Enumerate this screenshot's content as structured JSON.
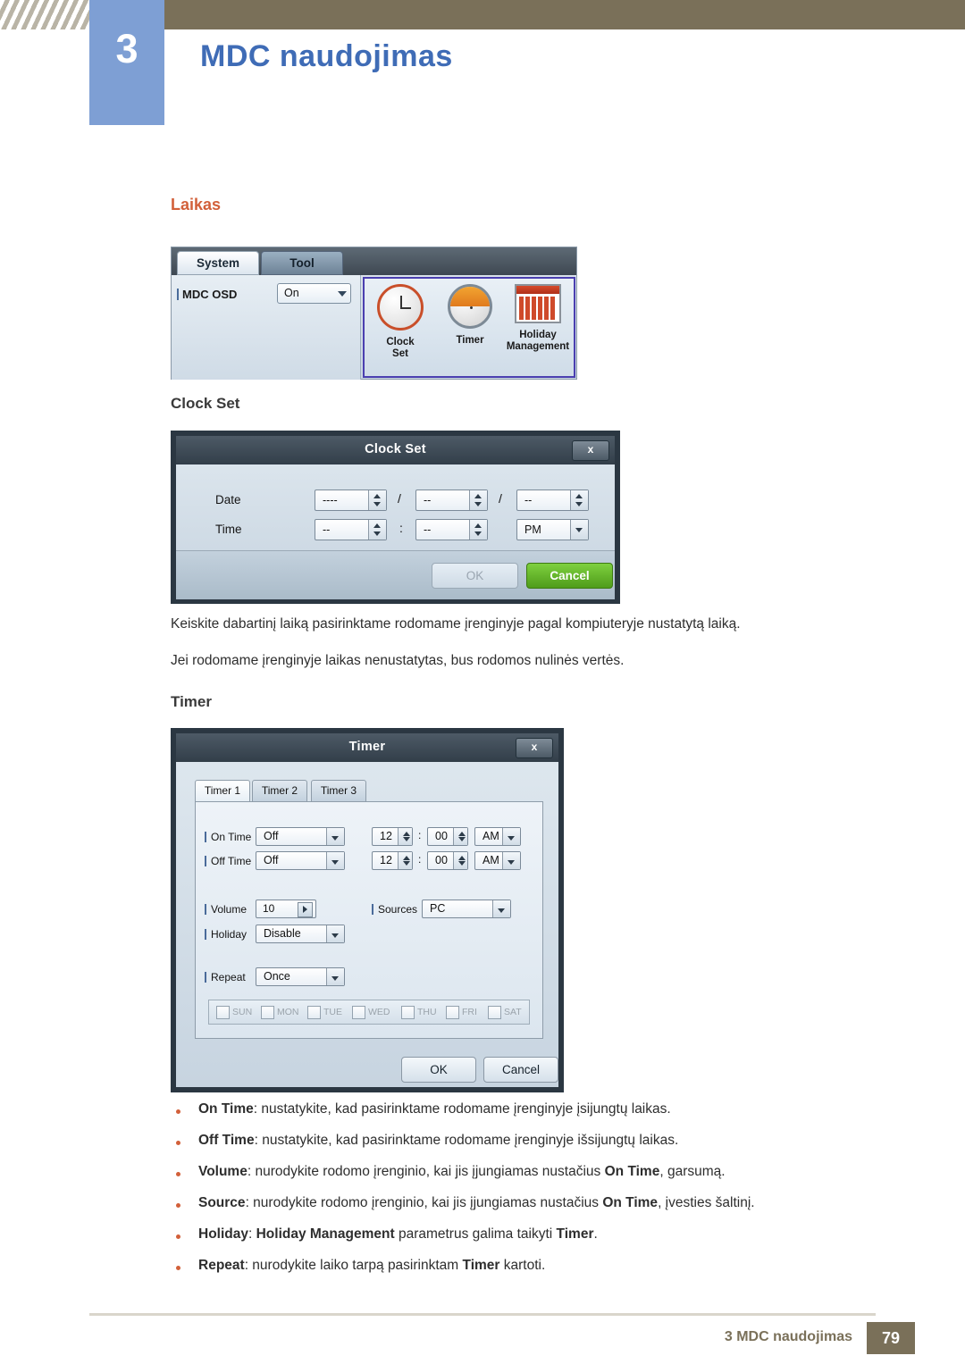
{
  "header": {
    "chapter_number": "3",
    "chapter_title": "MDC naudojimas"
  },
  "section": {
    "title": "Laikas",
    "sub_clock": "Clock Set",
    "sub_timer": "Timer"
  },
  "tool_panel": {
    "tab_system": "System",
    "tab_tool": "Tool",
    "osd_label": "MDC OSD",
    "osd_value": "On",
    "icons": [
      {
        "label1": "Clock",
        "label2": "Set",
        "icon": "clock-icon"
      },
      {
        "label1": "Timer",
        "label2": "",
        "icon": "timer-icon"
      },
      {
        "label1": "Holiday",
        "label2": "Management",
        "icon": "calendar-icon"
      }
    ]
  },
  "clock_dialog": {
    "title": "Clock Set",
    "close": "x",
    "date_label": "Date",
    "time_label": "Time",
    "date_year": "----",
    "date_month": "--",
    "date_day": "--",
    "date_sep1": "/",
    "date_sep2": "/",
    "time_hour": "--",
    "time_minute": "--",
    "time_sep": ":",
    "time_ampm": "PM",
    "ok": "OK",
    "cancel": "Cancel"
  },
  "paragraphs": {
    "p1": "Keiskite dabartinį laiką pasirinktame rodomame įrenginyje pagal kompiuteryje nustatytą laiką.",
    "p2": "Jei rodomame įrenginyje laikas nenustatytas, bus rodomos nulinės vertės."
  },
  "timer_dialog": {
    "title": "Timer",
    "close": "x",
    "tabs": [
      "Timer 1",
      "Timer 2",
      "Timer 3"
    ],
    "on_time_label": "On Time",
    "on_time_value": "Off",
    "on_time_hour": "12",
    "on_time_min": "00",
    "on_time_ampm": "AM",
    "off_time_label": "Off Time",
    "off_time_value": "Off",
    "off_time_hour": "12",
    "off_time_min": "00",
    "off_time_ampm": "AM",
    "volume_label": "Volume",
    "volume_value": "10",
    "sources_label": "Sources",
    "sources_value": "PC",
    "holiday_label": "Holiday",
    "holiday_value": "Disable",
    "repeat_label": "Repeat",
    "repeat_value": "Once",
    "days": [
      "SUN",
      "MON",
      "TUE",
      "WED",
      "THU",
      "FRI",
      "SAT"
    ],
    "time_sep": ":",
    "ok": "OK",
    "cancel": "Cancel"
  },
  "bullets": [
    {
      "term": "On Time",
      "rest": ": nustatykite, kad pasirinktame rodomame įrenginyje įsijungtų laikas."
    },
    {
      "term": "Off Time",
      "rest": ": nustatykite, kad pasirinktame rodomame įrenginyje išsijungtų laikas."
    },
    {
      "term": "Volume",
      "rest": ": nurodykite rodomo įrenginio, kai jis įjungiamas nustačius ",
      "term2": "On Time",
      "rest2": ", garsumą."
    },
    {
      "term": "Source",
      "rest": ": nurodykite rodomo įrenginio, kai jis įjungiamas nustačius ",
      "term2": "On Time",
      "rest2": ", įvesties šaltinį."
    },
    {
      "term": "Holiday",
      "rest": ": ",
      "term2": "Holiday Management",
      "rest2": " parametrus galima taikyti ",
      "term3": "Timer",
      "rest3": "."
    },
    {
      "term": "Repeat",
      "rest": ": nurodykite laiko tarpą pasirinktam ",
      "term2": "Timer",
      "rest2": " kartoti."
    }
  ],
  "footer": {
    "text": "3 MDC naudojimas",
    "page": "79"
  }
}
